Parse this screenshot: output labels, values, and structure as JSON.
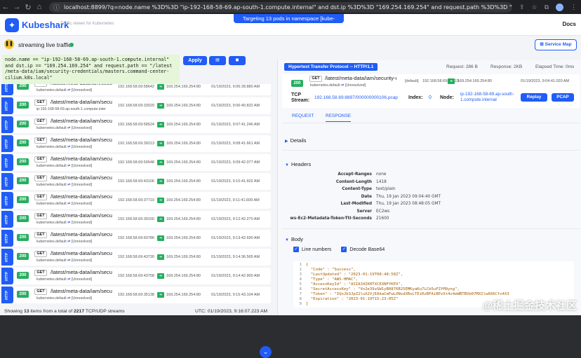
{
  "browser": {
    "url": "localhost:8899/?q=node.name %3D%3D \"ip-192-168-58-69.ap-south-1.compute.internal\" and dst.ip %3D%3D \"169.254.169.254\" and request.path %3D%3D \"%2Flatest%2Fmeta-"
  },
  "header": {
    "brand": "Kubeshark",
    "tagline": "Traffic viewer for Kubernetes",
    "banner": "Targeting 13 pods in namespace [kube-system]",
    "docs": "Docs"
  },
  "status": {
    "streaming": "streaming live traffic",
    "service_map": "Service Map"
  },
  "filter": {
    "line1": "node.name == \"ip-192-168-58-69.ap-south-1.compute.internal\"",
    "line2": "and dst.ip == \"169.254.169.254\" and request.path == \"/latest",
    "line3": "/meta-data/iam/security-credentials/masters.command-center-",
    "line4": "cilium.k8s.local\"",
    "apply": "Apply"
  },
  "entries": [
    {
      "protocol": "HTTP",
      "status": "200",
      "method": "GET",
      "path": "/latest/meta-data/iam/securit",
      "service": "kubernetes.default",
      "resolved": "[Unresolved]",
      "src": "192.168.58.69:58642",
      "dst": "169.254.169.254:80",
      "time": "01/19/2023, 9:06:28.880 AM"
    },
    {
      "protocol": "HTTP",
      "status": "200",
      "method": "GET",
      "path": "/latest/meta-data/iam/securit",
      "service": "ip-192-168-58-69.ap-south-1.compute.inter",
      "resolved": "",
      "src": "192.168.58.69:33029",
      "dst": "169.254.169.254:80",
      "time": "01/19/2023, 9:06:40.832 AM"
    },
    {
      "protocol": "HTTP",
      "status": "200",
      "method": "GET",
      "path": "/latest/meta-data/iam/securit",
      "service": "kubernetes.default",
      "resolved": "[Unresolved]",
      "src": "192.168.58.69:58524",
      "dst": "169.254.169.254:80",
      "time": "01/19/2023, 9:07:41.246 AM"
    },
    {
      "protocol": "HTTP",
      "status": "200",
      "method": "GET",
      "path": "/latest/meta-data/iam/securit",
      "service": "kubernetes.default",
      "resolved": "[Unresolved]",
      "src": "192.168.58.69:39213",
      "dst": "169.254.169.254:80",
      "time": "01/19/2023, 9:08:41.661 AM"
    },
    {
      "protocol": "HTTP",
      "status": "200",
      "method": "GET",
      "path": "/latest/meta-data/iam/securit",
      "service": "kubernetes.default",
      "resolved": "[Unresolved]",
      "src": "192.168.58.69:59548",
      "dst": "169.254.169.254:80",
      "time": "01/19/2023, 9:09:42.077 AM"
    },
    {
      "protocol": "HTTP",
      "status": "200",
      "method": "GET",
      "path": "/latest/meta-data/iam/securit",
      "service": "kubernetes.default",
      "resolved": "[Unresolved]",
      "src": "192.168.58.69:43106",
      "dst": "169.254.169.254:80",
      "time": "01/19/2023, 9:10:41.602 AM"
    },
    {
      "protocol": "HTTP",
      "status": "200",
      "method": "GET",
      "path": "/latest/meta-data/iam/securit",
      "service": "kubernetes.default",
      "resolved": "[Unresolved]",
      "src": "192.168.58.69:37710",
      "dst": "169.254.169.254:80",
      "time": "01/19/2023, 9:11:41.609 AM"
    },
    {
      "protocol": "HTTP",
      "status": "200",
      "method": "GET",
      "path": "/latest/meta-data/iam/securit",
      "service": "kubernetes.default",
      "resolved": "[Unresolved]",
      "src": "192.168.58.69:39150",
      "dst": "169.254.169.254:80",
      "time": "01/19/2023, 9:12:42.270 AM"
    },
    {
      "protocol": "HTTP",
      "status": "200",
      "method": "GET",
      "path": "/latest/meta-data/iam/securit",
      "service": "kubernetes.default",
      "resolved": "[Unresolved]",
      "src": "192.168.58.69:60786",
      "dst": "169.254.169.254:80",
      "time": "01/19/2023, 9:13:42.690 AM"
    },
    {
      "protocol": "HTTP",
      "status": "200",
      "method": "GET",
      "path": "/latest/meta-data/iam/securit",
      "service": "kubernetes.default",
      "resolved": "[Unresolved]",
      "src": "192.168.58.69:43730",
      "dst": "169.254.169.254:80",
      "time": "01/19/2023, 9:14:36.565 AM"
    },
    {
      "protocol": "HTTP",
      "status": "200",
      "method": "GET",
      "path": "/latest/meta-data/iam/securit",
      "service": "kubernetes.default",
      "resolved": "[Unresolved]",
      "src": "192.168.58.69:43758",
      "dst": "169.254.169.254:80",
      "time": "01/19/2023, 9:14:42.900 AM"
    },
    {
      "protocol": "HTTP",
      "status": "200",
      "method": "GET",
      "path": "/latest/meta-data/iam/securit",
      "service": "kubernetes.default",
      "resolved": "[Unresolved]",
      "src": "192.168.58.69:35138",
      "dst": "169.254.169.254:80",
      "time": "01/19/2023, 9:15:43.104 AM"
    }
  ],
  "footer": {
    "showing_prefix": "Showing ",
    "showing_count": "13",
    "showing_mid": " items from a total of ",
    "showing_total": "2217",
    "showing_suffix": " TCP/UDP streams",
    "utc": "UTC: 01/19/2023, 9:16:07.223 AM"
  },
  "detail": {
    "protocol": "Hypertext Transfer Protocol -- HTTP/1.1",
    "request_size": "Request: 286 B",
    "response_size": "Response: 2KB",
    "elapsed": "Elapsed Time: 0ms",
    "status": "200",
    "method": "GET",
    "path": "/latest/meta-data/iam/security-cre",
    "service": "kubernetes.default",
    "resolved": "[Unresolved]",
    "default": "[default]",
    "src": "192.168.58.69:49219",
    "dst": "169.254.169.254:80",
    "time": "01/19/2023, 9:04:41.020 AM",
    "tcp_label_1": "TCP",
    "tcp_label_2": "Stream:",
    "tcp_value": "192.168.58.69:8897/000000000106.pcap",
    "index_label": "Index:",
    "index_value": "0",
    "node_label": "Node:",
    "node_value": "ip-192-168-58-69.ap-south-1.compute.internal",
    "replay": "Replay",
    "pcap": "PCAP",
    "tab_request": "REQUEST",
    "tab_response": "RESPONSE",
    "details": "Details",
    "headers_title": "Headers",
    "headers": [
      {
        "key": "Accept-Ranges",
        "value": "none"
      },
      {
        "key": "Content-Length",
        "value": "1418"
      },
      {
        "key": "Content-Type",
        "value": "text/plain"
      },
      {
        "key": "Date",
        "value": "Thu, 19 Jan 2023 09:04:40 GMT"
      },
      {
        "key": "Last-Modified",
        "value": "Thu, 19 Jan 2023 08:48:05 GMT"
      },
      {
        "key": "Server",
        "value": "EC2ws"
      },
      {
        "key": "ws-Ec2-Metadata-Token-Ttl-Seconds",
        "value": "21600"
      }
    ],
    "body_title": "Body",
    "line_numbers": "Line numbers",
    "decode": "Decode Base64",
    "code_lines": [
      "{",
      "  \"Code\" : \"Success\",",
      "  \"LastUpdated\" : \"2023-01-19T08:48:58Z\",",
      "  \"Type\" : \"AWS-HMAC\",",
      "  \"AccessKeyId\" : \"ASIA34IKHTXCEXNFYKPX\",",
      "  \"SecretAccessKey\" : \"Vn2e39zGW1yB0876B25EMKyaKu7LCb5uFZfM9yng\",",
      "  \"Token\" : \"IQoJb3JpZ2luX2VjEAkaCmFwLXNvdXRoLTEiRzBFAiBPzX+4v4eWBTBVb07MXIlw0X6Cfs4X3",
      "  \"Expiration\" : \"2023-01-19T15:23:05Z\"",
      "}"
    ]
  },
  "watermark": "@稀土掘金技术社区",
  "colors": {
    "accent": "#205cf5",
    "success": "#27ae60",
    "filter_bg": "#e5f6d9",
    "pause": "#f5c431"
  }
}
